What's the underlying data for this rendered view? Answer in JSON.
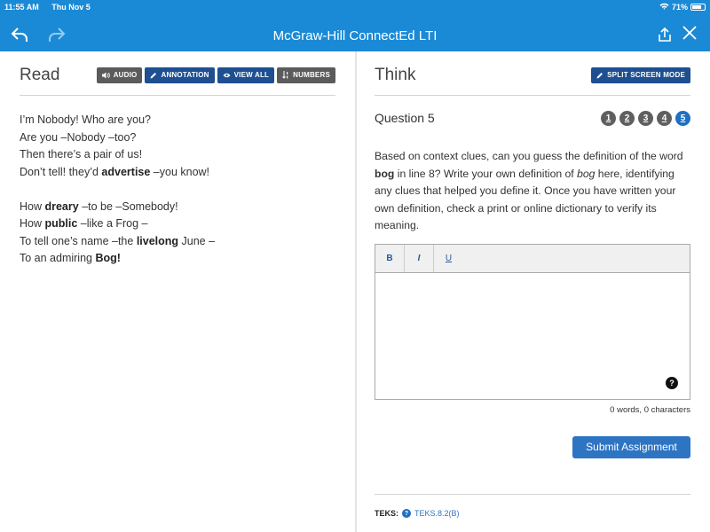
{
  "status_bar": {
    "time": "11:55 AM",
    "date": "Thu Nov 5",
    "battery": "71%"
  },
  "nav": {
    "title": "McGraw-Hill ConnectEd LTI"
  },
  "read": {
    "title": "Read",
    "tools": [
      {
        "label": "AUDIO",
        "icon": "speaker-icon",
        "color": "#5b5b5b"
      },
      {
        "label": "ANNOTATION",
        "icon": "pencil-icon",
        "color": "#1d4f91"
      },
      {
        "label": "VIEW ALL",
        "icon": "eye-icon",
        "color": "#1d4f91"
      },
      {
        "label": "NUMBERS",
        "icon": "sort-numbers-icon",
        "color": "#5b5b5b"
      }
    ],
    "stanzas": [
      [
        {
          "parts": [
            {
              "t": "I’m Nobody! Who are you?"
            }
          ]
        },
        {
          "parts": [
            {
              "t": "Are you –Nobody –too?"
            }
          ]
        },
        {
          "parts": [
            {
              "t": "Then there’s a pair of us!"
            }
          ]
        },
        {
          "parts": [
            {
              "t": "Don’t tell! they’d "
            },
            {
              "t": "advertise",
              "b": true
            },
            {
              "t": " –you know!"
            }
          ]
        }
      ],
      [
        {
          "parts": [
            {
              "t": "How "
            },
            {
              "t": "dreary",
              "b": true
            },
            {
              "t": " –to be –Somebody!"
            }
          ]
        },
        {
          "parts": [
            {
              "t": "How "
            },
            {
              "t": "public",
              "b": true
            },
            {
              "t": " –like a Frog –"
            }
          ]
        },
        {
          "parts": [
            {
              "t": "To tell one’s name –the "
            },
            {
              "t": "livelong",
              "b": true
            },
            {
              "t": " June –"
            }
          ]
        },
        {
          "parts": [
            {
              "t": "To an admiring "
            },
            {
              "t": "Bog!",
              "b": true
            }
          ]
        }
      ]
    ]
  },
  "think": {
    "title": "Think",
    "split_label": "SPLIT SCREEN MODE",
    "question_title": "Question 5",
    "questions": [
      "1",
      "2",
      "3",
      "4",
      "5"
    ],
    "active_question": 5,
    "prompt": {
      "p1": "Based on context clues, can you guess the definition of the word ",
      "b1": "bog",
      "p2": " in line 8? Write your own definition of ",
      "i1": "bog",
      "p3": " here, identifying any clues that helped you define it. Once you have written your own definition, check a print or online dictionary to verify its meaning."
    },
    "editor": {
      "bold": "B",
      "italic": "I",
      "underline": "U",
      "value": "",
      "help": "?"
    },
    "counter": "0 words, 0 characters",
    "submit_label": "Submit Assignment",
    "teks_label": "TEKS:",
    "teks_link": "TEKS.8.2(B)"
  },
  "colors": {
    "accent": "#1b8ad6",
    "primary_button": "#2d74c2",
    "tool_blue": "#1d4f91",
    "tool_gray": "#5b5b5b"
  }
}
